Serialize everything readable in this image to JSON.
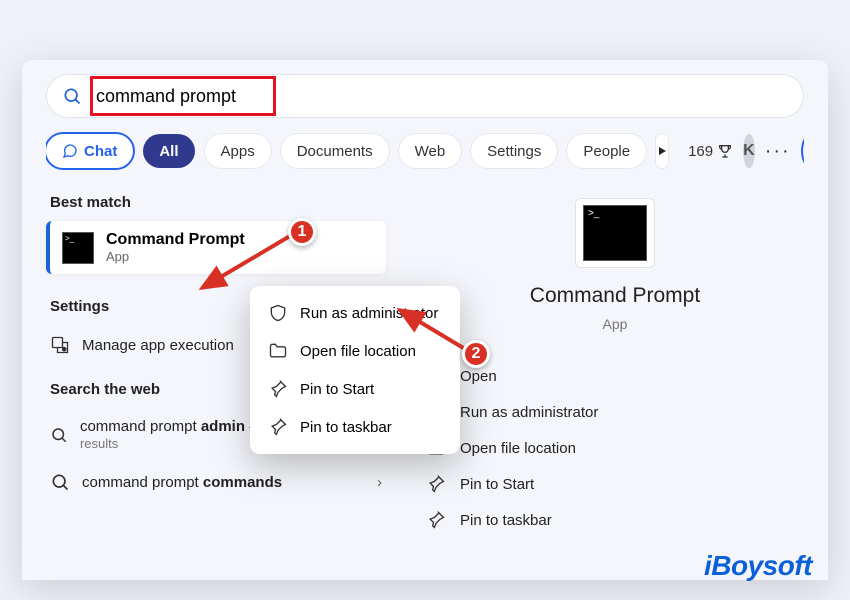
{
  "search": {
    "query": "command prompt"
  },
  "filters": {
    "chat": "Chat",
    "all": "All",
    "apps": "Apps",
    "documents": "Documents",
    "web": "Web",
    "settings": "Settings",
    "people": "People"
  },
  "rewards": {
    "points": "169"
  },
  "avatar_initial": "K",
  "best_match_label": "Best match",
  "best_match": {
    "title": "Command Prompt",
    "subtitle": "App"
  },
  "settings_label": "Settings",
  "settings_items": [
    {
      "label": "Manage app execution"
    }
  ],
  "search_web_label": "Search the web",
  "web_items": [
    {
      "prefix": "command prompt ",
      "bold": "admin",
      "suffix": " - See more search results"
    },
    {
      "prefix": "command prompt ",
      "bold": "commands",
      "suffix": ""
    }
  ],
  "context_menu": [
    {
      "icon": "shield",
      "label": "Run as administrator"
    },
    {
      "icon": "folder",
      "label": "Open file location"
    },
    {
      "icon": "pin-start",
      "label": "Pin to Start"
    },
    {
      "icon": "pin-taskbar",
      "label": "Pin to taskbar"
    }
  ],
  "details": {
    "title": "Command Prompt",
    "subtitle": "App",
    "open_label": "Open",
    "actions": [
      {
        "icon": "shield",
        "label": "Run as administrator"
      },
      {
        "icon": "folder",
        "label": "Open file location"
      },
      {
        "icon": "pin-start",
        "label": "Pin to Start"
      },
      {
        "icon": "pin-taskbar",
        "label": "Pin to taskbar"
      }
    ]
  },
  "annotations": {
    "step1": "1",
    "step2": "2"
  },
  "watermark": "iBoysoft"
}
